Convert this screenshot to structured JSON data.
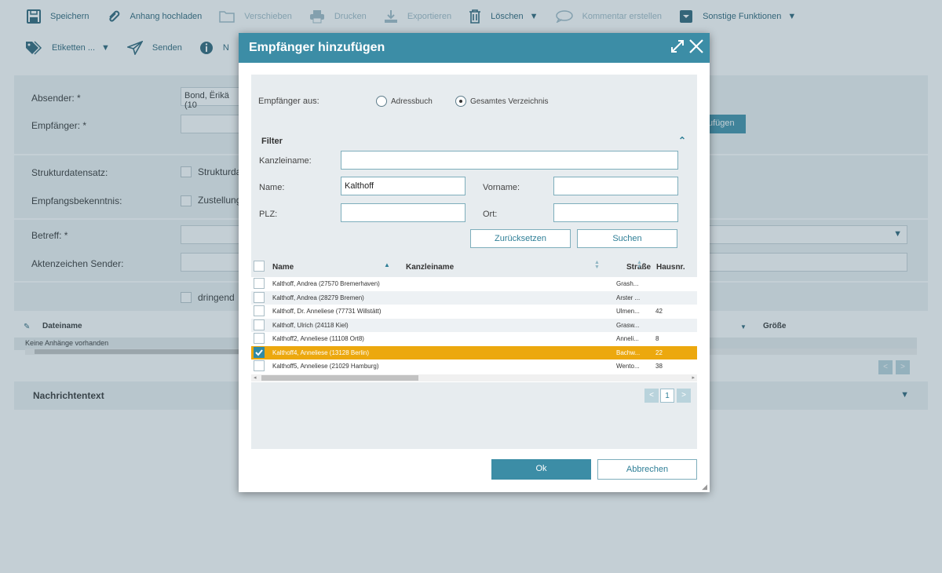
{
  "toolbar1": {
    "save": "Speichern",
    "attach": "Anhang hochladen",
    "move": "Verschieben",
    "print": "Drucken",
    "export": "Exportieren",
    "delete": "Löschen",
    "comment": "Kommentar erstellen",
    "other": "Sonstige Funktionen"
  },
  "toolbar2": {
    "labels": "Etiketten ...",
    "send": "Senden",
    "info": "N"
  },
  "form": {
    "sender_label": "Absender: *",
    "sender_value": "Bond, Ërikä (10",
    "recipient_label": "Empfänger: *",
    "add_recipient_partial": "ufügen",
    "struct_label": "Strukturdatensatz:",
    "struct_cb": "Strukturda",
    "receipt_label": "Empfangsbekenntnis:",
    "receipt_cb": "Zustellung",
    "subject_label": "Betreff: *",
    "ref_label": "Aktenzeichen Sender:",
    "urgent_cb": "dringend",
    "file_col": "Dateiname",
    "size_col": "Größe",
    "no_attachments": "Keine Anhänge vorhanden",
    "message_text": "Nachrichtentext"
  },
  "dialog": {
    "title": "Empfänger hinzufügen",
    "source_label": "Empfänger aus:",
    "source_options": [
      "Adressbuch",
      "Gesamtes Verzeichnis"
    ],
    "source_selected": 1,
    "filter": {
      "title": "Filter",
      "firm_label": "Kanzleiname:",
      "firm_value": "",
      "name_label": "Name:",
      "name_value": "Kalthoff",
      "firstname_label": "Vorname:",
      "firstname_value": "",
      "zip_label": "PLZ:",
      "zip_value": "",
      "city_label": "Ort:",
      "city_value": "",
      "reset": "Zurücksetzen",
      "search": "Suchen"
    },
    "table": {
      "columns": [
        "Name",
        "Kanzleiname",
        "Straße",
        "Hausnr."
      ],
      "rows": [
        {
          "name": "Kalthoff, Andrea (27570 Bremerhaven)",
          "street": "Grash...",
          "no": "",
          "selected": false
        },
        {
          "name": "Kalthoff, Andrea (28279 Bremen)",
          "street": "Arster ...",
          "no": "",
          "selected": false
        },
        {
          "name": "Kalthoff, Dr. Anneliese (77731 Willstätt)",
          "street": "Ulmen...",
          "no": "42",
          "selected": false
        },
        {
          "name": "Kalthoff, Ulrich (24118 Kiel)",
          "street": "Grasw...",
          "no": "",
          "selected": false
        },
        {
          "name": "Kalthoff2, Anneliese (11108 Ort8)",
          "street": "Anneli...",
          "no": "8",
          "selected": false
        },
        {
          "name": "Kalthoff4, Anneliese (13128 Berlin)",
          "street": "Bachw...",
          "no": "22",
          "selected": true
        },
        {
          "name": "Kalthoff5, Anneliese (21029 Hamburg)",
          "street": "Wento...",
          "no": "38",
          "selected": false
        }
      ]
    },
    "pagination": {
      "prev": "<",
      "page": "1",
      "next": ">"
    },
    "ok": "Ok",
    "cancel": "Abbrechen"
  }
}
